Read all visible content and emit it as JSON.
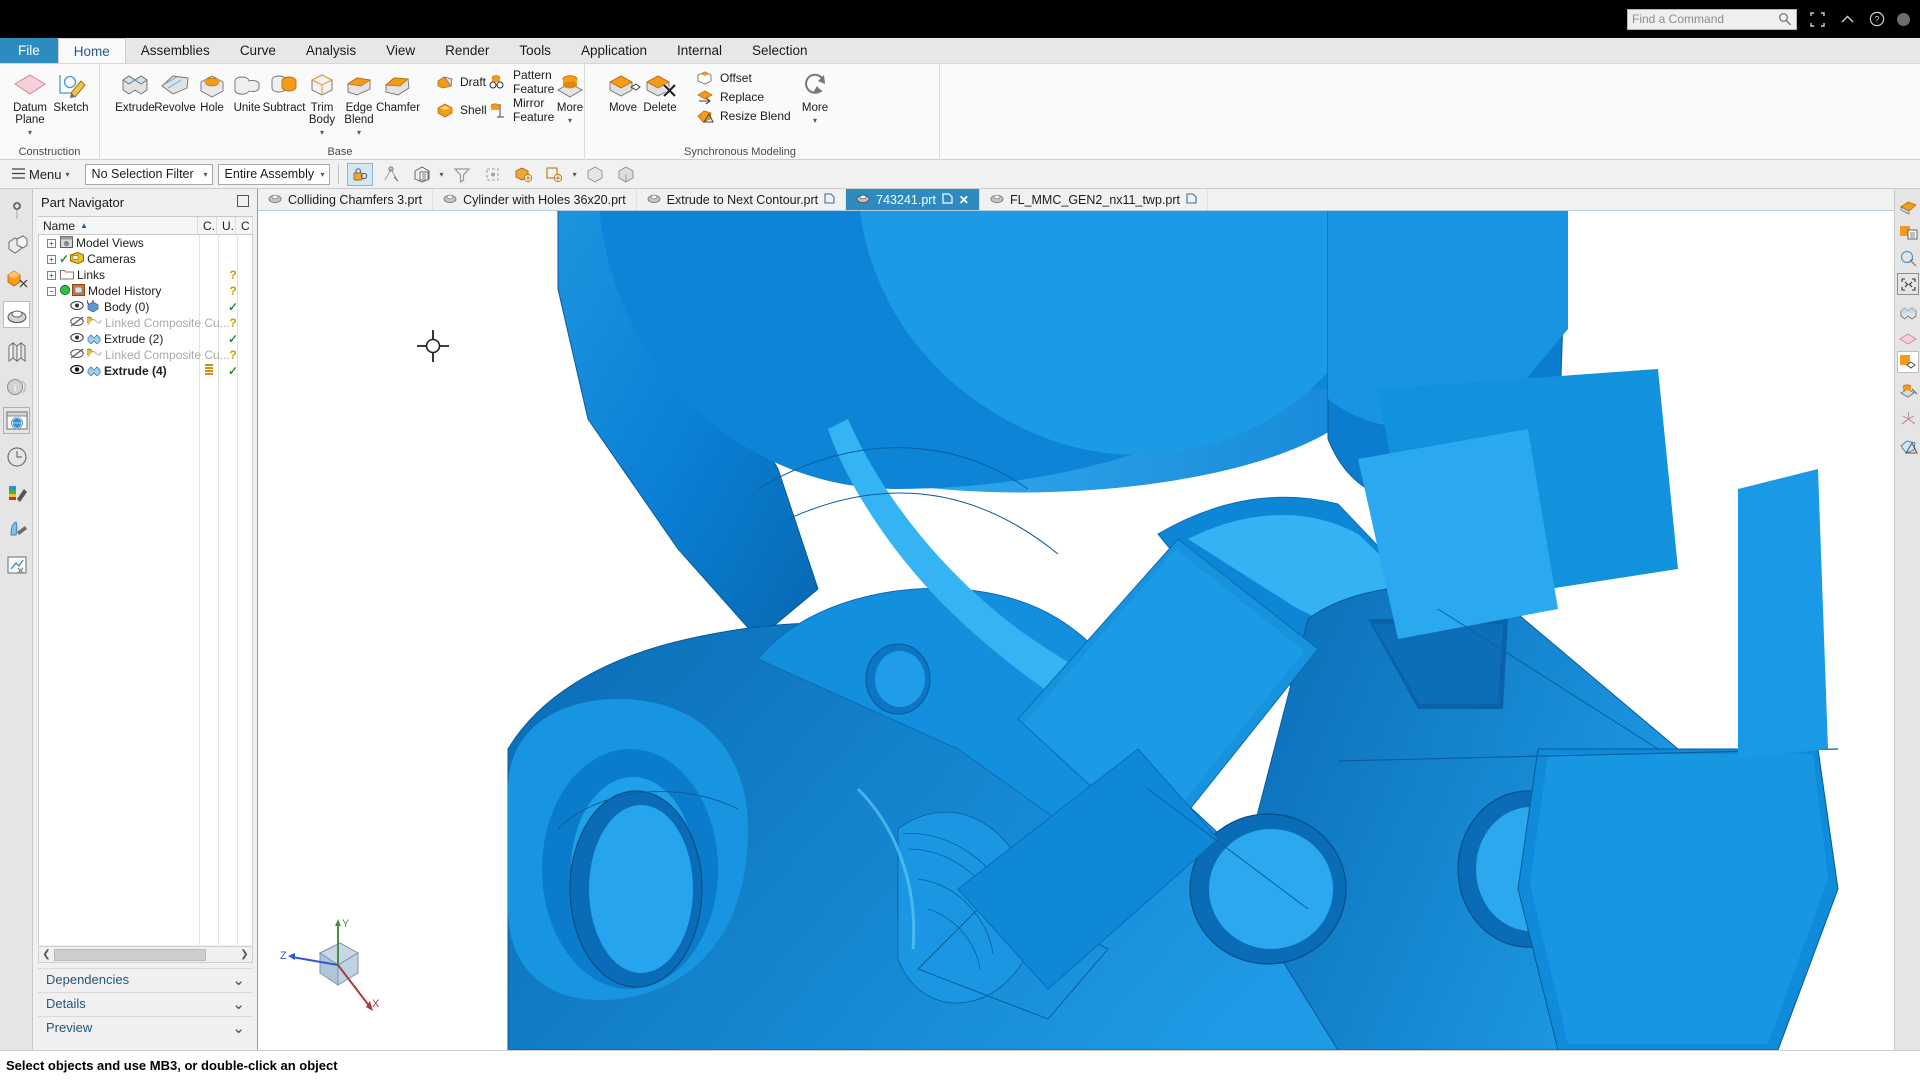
{
  "window": {
    "find_placeholder": "Find a Command",
    "icons": [
      "search-icon",
      "fullscreen-icon",
      "minimize-ribbon-icon",
      "help-icon",
      "account-icon"
    ]
  },
  "ribbon": {
    "tabs": [
      {
        "label": "File",
        "state": "file"
      },
      {
        "label": "Home",
        "state": "active"
      },
      {
        "label": "Assemblies",
        "state": "normal"
      },
      {
        "label": "Curve",
        "state": "normal"
      },
      {
        "label": "Analysis",
        "state": "normal"
      },
      {
        "label": "View",
        "state": "normal"
      },
      {
        "label": "Render",
        "state": "normal"
      },
      {
        "label": "Tools",
        "state": "normal"
      },
      {
        "label": "Application",
        "state": "normal"
      },
      {
        "label": "Internal",
        "state": "normal"
      },
      {
        "label": "Selection",
        "state": "normal"
      }
    ],
    "groups": [
      {
        "name": "Construction",
        "label": "Construction"
      },
      {
        "name": "Base",
        "label": "Base"
      },
      {
        "name": "Synchronous Modeling",
        "label": "Synchronous Modeling"
      }
    ],
    "construction_buttons": [
      {
        "label": "Datum\nPlane",
        "icon": "datum-plane-icon",
        "dropdown": true
      },
      {
        "label": "Sketch",
        "icon": "sketch-icon",
        "dropdown": false
      }
    ],
    "base_buttons": [
      {
        "label": "Extrude",
        "icon": "extrude-icon",
        "dropdown": false
      },
      {
        "label": "Revolve",
        "icon": "revolve-icon",
        "dropdown": false
      },
      {
        "label": "Hole",
        "icon": "hole-icon",
        "dropdown": false
      },
      {
        "label": "Unite",
        "icon": "unite-icon",
        "dropdown": false
      },
      {
        "label": "Subtract",
        "icon": "subtract-icon",
        "dropdown": false
      },
      {
        "label": "Trim\nBody",
        "icon": "trim-body-icon",
        "dropdown": true
      },
      {
        "label": "Edge\nBlend",
        "icon": "edge-blend-icon",
        "dropdown": true
      },
      {
        "label": "Chamfer",
        "icon": "chamfer-icon",
        "dropdown": false
      }
    ],
    "base_small_buttons": [
      {
        "label": "Draft",
        "icon": "draft-icon"
      },
      {
        "label": "Shell",
        "icon": "shell-icon"
      },
      {
        "label": "Pattern Feature",
        "icon": "pattern-feature-icon"
      },
      {
        "label": "Mirror Feature",
        "icon": "mirror-feature-icon"
      }
    ],
    "base_more": {
      "label": "More",
      "icon": "more-icon"
    },
    "sync_buttons": [
      {
        "label": "Move",
        "icon": "move-face-icon"
      },
      {
        "label": "Delete",
        "icon": "delete-face-icon"
      }
    ],
    "sync_small_buttons": [
      {
        "label": "Offset",
        "icon": "offset-region-icon"
      },
      {
        "label": "Replace",
        "icon": "replace-face-icon"
      },
      {
        "label": "Resize Blend",
        "icon": "resize-blend-icon"
      }
    ],
    "sync_more": {
      "label": "More",
      "icon": "more-refresh-icon"
    }
  },
  "command_bar": {
    "menu_label": "Menu",
    "selection_filter": "No Selection Filter",
    "scope": "Entire Assembly",
    "quick_icons": [
      "selection-lock-icon",
      "snap-point-icon",
      "face-finder-icon",
      "filter-icon",
      "attach-icon",
      "select-object-icon",
      "select-feature-icon",
      "chain-icon",
      "solid-body-icon"
    ]
  },
  "left_rail": {
    "items": [
      {
        "name": "assembly-navigator-icon",
        "selected": false
      },
      {
        "name": "constraint-navigator-icon",
        "selected": false
      },
      {
        "name": "model-view-icon",
        "selected": false
      },
      {
        "name": "part-navigator-icon",
        "selected": true
      },
      {
        "name": "reuse-library-icon",
        "selected": false
      },
      {
        "name": "hd3d-tools-icon",
        "selected": false
      },
      {
        "name": "web-browser-icon",
        "selected": false
      },
      {
        "name": "history-icon",
        "selected": false
      },
      {
        "name": "system-materials-icon",
        "selected": false
      },
      {
        "name": "system-scene-icon",
        "selected": false
      },
      {
        "name": "process-studio-icon",
        "selected": false
      }
    ]
  },
  "right_rail": {
    "items": [
      {
        "name": "render-style-icon",
        "selected": false
      },
      {
        "name": "layer-settings-icon",
        "selected": false
      },
      {
        "name": "view-section-icon",
        "selected": false
      },
      {
        "name": "fit-view-icon",
        "selected": false
      },
      {
        "name": "orient-view-icon",
        "selected": false
      },
      {
        "name": "datum-display-icon",
        "selected": false
      },
      {
        "name": "move-object-icon",
        "selected": true
      },
      {
        "name": "edit-object-display-icon",
        "selected": false
      },
      {
        "name": "wcs-icon",
        "selected": false
      },
      {
        "name": "section-analysis-icon",
        "selected": false
      }
    ]
  },
  "part_navigator": {
    "title": "Part Navigator",
    "columns": [
      "Name",
      "C.",
      "U.",
      "C"
    ],
    "sort_indicator": "▲",
    "rows": [
      {
        "label": "Model Views",
        "indent": 0,
        "expander": "+",
        "icon": "model-views-icon",
        "check": "",
        "update": "",
        "muted": false,
        "bold": false
      },
      {
        "label": "Cameras",
        "indent": 0,
        "expander": "+",
        "icon": "cameras-icon",
        "check": "",
        "update": "",
        "muted": false,
        "bold": false
      },
      {
        "label": "Links",
        "indent": 0,
        "expander": "+",
        "icon": "links-folder-icon",
        "check": "",
        "update": "?",
        "muted": false,
        "bold": false
      },
      {
        "label": "Model History",
        "indent": 0,
        "expander": "−",
        "icon": "model-history-icon",
        "check": "",
        "update": "?",
        "muted": false,
        "bold": false
      },
      {
        "label": "Body (0)",
        "indent": 1,
        "expander": "",
        "icon": "body-icon",
        "check": "",
        "update": "✓",
        "muted": false,
        "bold": false
      },
      {
        "label": "Linked Composite Cu...",
        "indent": 1,
        "expander": "",
        "icon": "linked-composite-curve-icon",
        "check": "",
        "update": "?",
        "muted": true,
        "bold": false
      },
      {
        "label": "Extrude (2)",
        "indent": 1,
        "expander": "",
        "icon": "extrude-feature-icon",
        "check": "",
        "update": "✓",
        "muted": false,
        "bold": false
      },
      {
        "label": "Linked Composite Cu...",
        "indent": 1,
        "expander": "",
        "icon": "linked-composite-curve-icon",
        "check": "",
        "update": "?",
        "muted": true,
        "bold": false
      },
      {
        "label": "Extrude (4)",
        "indent": 1,
        "expander": "",
        "icon": "extrude-feature-icon",
        "check": "",
        "update": "✓",
        "muted": false,
        "bold": true
      }
    ],
    "accordions": [
      {
        "label": "Dependencies",
        "chevron": "⌄"
      },
      {
        "label": "Details",
        "chevron": "⌄"
      },
      {
        "label": "Preview",
        "chevron": "⌄"
      }
    ]
  },
  "document_tabs": [
    {
      "label": "Colliding Chamfers 3.prt",
      "active": false,
      "modified": false,
      "closable": false
    },
    {
      "label": "Cylinder with Holes 36x20.prt",
      "active": false,
      "modified": false,
      "closable": false
    },
    {
      "label": "Extrude to Next Contour.prt",
      "active": false,
      "modified": true,
      "closable": false
    },
    {
      "label": "743241.prt",
      "active": true,
      "modified": true,
      "closable": true
    },
    {
      "label": "FL_MMC_GEN2_nx11_twp.prt",
      "active": false,
      "modified": true,
      "closable": false
    }
  ],
  "viewport": {
    "cursor": "crosshair-cursor",
    "triad": {
      "axes": [
        "Z",
        "Y",
        "X"
      ]
    },
    "model_color": "#0b7fd4",
    "model_highlight": "#2aa9f0",
    "background": "#ffffff"
  },
  "status_bar": {
    "message": "Select objects and use MB3, or double-click an object"
  }
}
